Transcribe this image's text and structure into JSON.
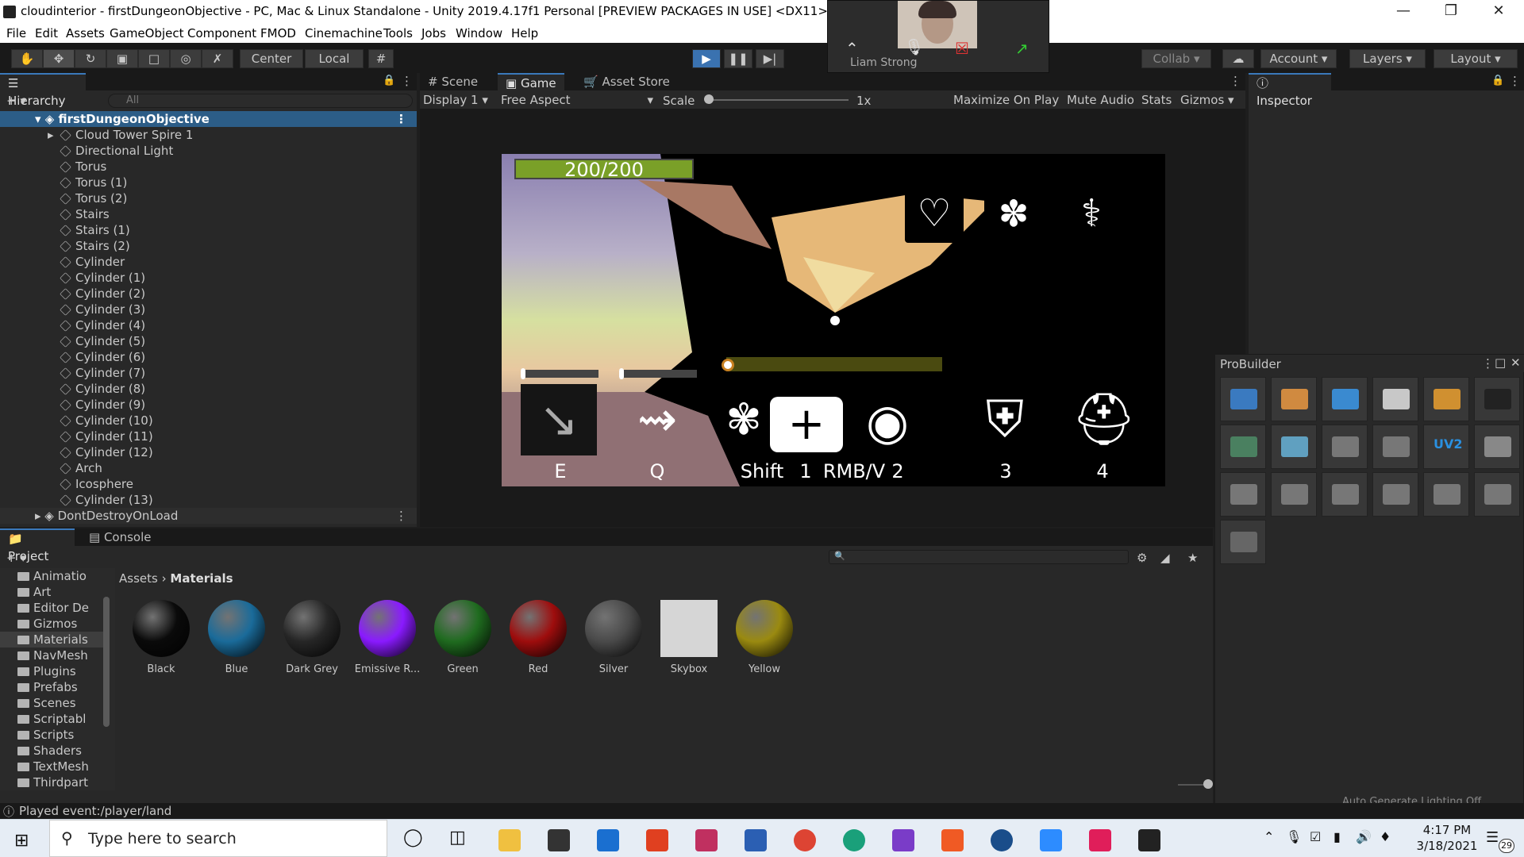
{
  "window": {
    "title": "cloudinterior - firstDungeonObjective - PC, Mac & Linux Standalone - Unity 2019.4.17f1 Personal [PREVIEW PACKAGES IN USE] <DX11>"
  },
  "menu": [
    "File",
    "Edit",
    "Assets",
    "GameObject",
    "Component",
    "FMOD",
    "Cinemachine",
    "Tools",
    "Jobs",
    "Window",
    "Help"
  ],
  "toolbar": {
    "pivot": "Center",
    "space": "Local",
    "collab": "Collab",
    "account": "Account",
    "layers": "Layers",
    "layout": "Layout"
  },
  "call": {
    "participant": "Liam Strong"
  },
  "hierarchy": {
    "tab": "Hierarchy",
    "search_placeholder": "All",
    "scene": "firstDungeonObjective",
    "items": [
      "Cloud Tower Spire 1",
      "Directional Light",
      "Torus",
      "Torus (1)",
      "Torus (2)",
      "Stairs",
      "Stairs (1)",
      "Stairs (2)",
      "Cylinder",
      "Cylinder (1)",
      "Cylinder (2)",
      "Cylinder (3)",
      "Cylinder (4)",
      "Cylinder (5)",
      "Cylinder (6)",
      "Cylinder (7)",
      "Cylinder (8)",
      "Cylinder (9)",
      "Cylinder (10)",
      "Cylinder (11)",
      "Cylinder (12)",
      "Arch",
      "Icosphere",
      "Cylinder (13)"
    ],
    "dont_destroy": "DontDestroyOnLoad"
  },
  "game_view": {
    "tabs": [
      "Scene",
      "Game",
      "Asset Store"
    ],
    "display": "Display 1",
    "aspect": "Free Aspect",
    "scale_label": "Scale",
    "scale_value": "1x",
    "options": [
      "Maximize On Play",
      "Mute Audio",
      "Stats",
      "Gizmos"
    ]
  },
  "hud": {
    "health_text": "200/200",
    "health_fraction": 1.0,
    "keys": [
      "E",
      "Q",
      "Shift",
      "1",
      "RMB/V",
      "2",
      "3",
      "4"
    ],
    "top_icons": [
      "hearts-icon",
      "wings-icon",
      "caduceus-icon"
    ]
  },
  "inspector": {
    "tab": "Inspector"
  },
  "probuilder": {
    "title": "ProBuilder",
    "uv_label": "UV2"
  },
  "project": {
    "tabs": [
      "Project",
      "Console"
    ],
    "folders": [
      "Animatio",
      "Art",
      "Editor De",
      "Gizmos",
      "Materials",
      "NavMesh",
      "Plugins",
      "Prefabs",
      "Scenes",
      "Scriptabl",
      "Scripts",
      "Shaders",
      "TextMesh",
      "Thirdpart"
    ],
    "breadcrumb": [
      "Assets",
      "Materials"
    ],
    "materials": [
      {
        "name": "Black",
        "color": "#0a0a0a"
      },
      {
        "name": "Blue",
        "color": "#1a6b9a"
      },
      {
        "name": "Dark Grey",
        "color": "#262626"
      },
      {
        "name": "Emissive R...",
        "color": "#8a1aff"
      },
      {
        "name": "Green",
        "color": "#1f6b1f"
      },
      {
        "name": "Red",
        "color": "#9e0d0d"
      },
      {
        "name": "Silver",
        "color": "#4a4a4a"
      },
      {
        "name": "Skybox",
        "color": "#d6d6d6"
      },
      {
        "name": "Yellow",
        "color": "#9a8a10"
      }
    ]
  },
  "status": {
    "message": "Played event:/player/land",
    "overlay": "Auto Generate Lighting Off"
  },
  "taskbar": {
    "search_placeholder": "Type here to search",
    "time": "4:17 PM",
    "date": "3/18/2021",
    "notifications": "29"
  }
}
